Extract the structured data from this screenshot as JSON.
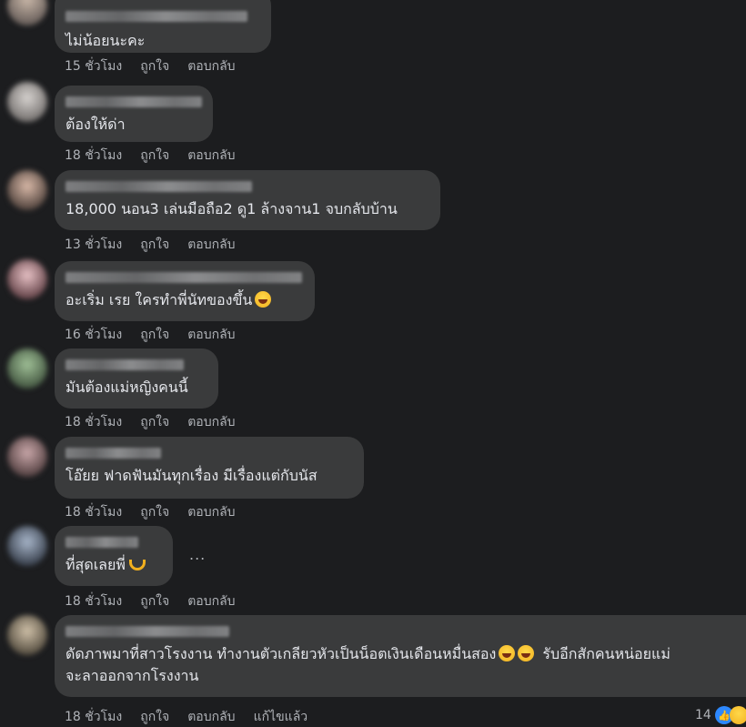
{
  "comments": [
    {
      "text": "ไม่น้อยนะคะ",
      "time": "15 ชั่วโมง",
      "like": "ถูกใจ",
      "reply": "ตอบกลับ",
      "emoji": ""
    },
    {
      "text": "ต้องให้ด่า",
      "time": "18 ชั่วโมง",
      "like": "ถูกใจ",
      "reply": "ตอบกลับ",
      "emoji": ""
    },
    {
      "text": "18,000 นอน3 เล่นมือถือ2 ดู1 ล้างจาน1 จบกลับบ้าน",
      "time": "13 ชั่วโมง",
      "like": "ถูกใจ",
      "reply": "ตอบกลับ",
      "emoji": ""
    },
    {
      "text": "อะเริ่ม เรย ใครทำพี่นัทของขึ้น",
      "time": "16 ชั่วโมง",
      "like": "ถูกใจ",
      "reply": "ตอบกลับ",
      "emoji": "laughing-face-emoji"
    },
    {
      "text": "มันต้องแม่หญิงคนนี้",
      "time": "18 ชั่วโมง",
      "like": "ถูกใจ",
      "reply": "ตอบกลับ",
      "emoji": ""
    },
    {
      "text": "โอ๊ยย ฟาดฟันมันทุกเรื่อง มีเรื่องแต่กับนัส",
      "time": "18 ชั่วโมง",
      "like": "ถูกใจ",
      "reply": "ตอบกลับ",
      "emoji": ""
    },
    {
      "text": "ที่สุดเลยพี่",
      "time": "18 ชั่วโมง",
      "like": "ถูกใจ",
      "reply": "ตอบกลับ",
      "emoji": "heart-hands-emoji",
      "more": "..."
    },
    {
      "text_line1": "ดัดภาพมาที่สาวโรงงาน ทำงานตัวเกลียวหัวเป็นน็อตเงินเดือนหมื่นสอง",
      "text_line1b": "รับอีกสักคนหน่อยแม่",
      "text_line2": "จะลาออกจากโรงงาน",
      "time": "18 ชั่วโมง",
      "like": "ถูกใจ",
      "reply": "ตอบกลับ",
      "edited": "แก้ไขแล้ว",
      "reaction_count": "14",
      "emoji": "laughing-face-emoji"
    }
  ],
  "icons": {
    "like_reaction": "thumbs-up-icon",
    "haha_reaction": "haha-face-icon"
  },
  "colors": {
    "background": "#1c1d1f",
    "bubble": "#3a3b3c",
    "text": "#e4e6eb",
    "meta": "#b0b3b8",
    "like_blue": "#2d88ff"
  }
}
